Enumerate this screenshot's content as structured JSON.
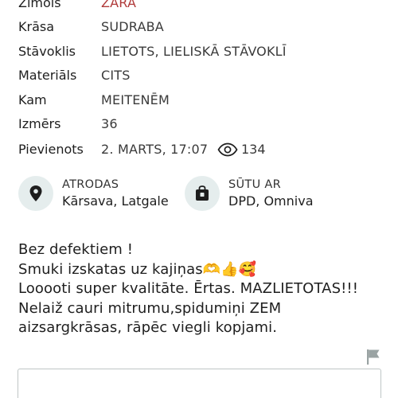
{
  "attributes": [
    {
      "label": "Zīmols",
      "value": "ZARA"
    },
    {
      "label": "Krāsa",
      "value": "SUDRABA"
    },
    {
      "label": "Stāvoklis",
      "value": "LIETOTS, LIELISKĀ STĀVOKLĪ"
    },
    {
      "label": "Materiāls",
      "value": "CITS"
    },
    {
      "label": "Kam",
      "value": "MEITENĒM"
    },
    {
      "label": "Izmērs",
      "value": "36"
    },
    {
      "label": "Pievienots",
      "value": "2. MARTS, 17:07",
      "views": "134"
    }
  ],
  "location": {
    "title": "ATRODAS",
    "value": "Kārsava, Latgale",
    "icon": "location-pin-icon"
  },
  "shipping": {
    "title": "SŪTU AR",
    "value": "DPD, Omniva",
    "icon": "package-icon"
  },
  "description": "Bez defektiem !\nSmuki izskatas uz kajiņas🫶👍🥰\nLooooti super kvalitāte. Ērtas. MAZLIETOTAS!!!\nNelaiž cauri mitrumu,spidumiņi ZEM\naizsargkrāsas, rāpēc viegli kopjami.",
  "colors": {
    "brand": "#b03a3a",
    "icon_bg": "#e5eded",
    "flag": "#9aa3a3"
  }
}
